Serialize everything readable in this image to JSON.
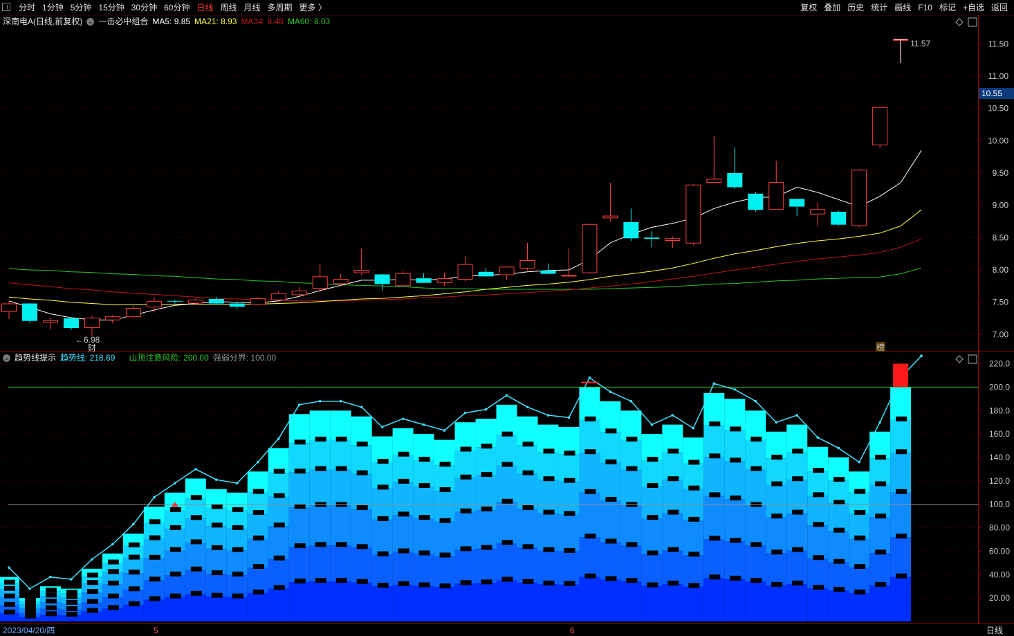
{
  "toolbar": {
    "tabs": [
      "分时",
      "1分钟",
      "5分钟",
      "15分钟",
      "30分钟",
      "60分钟",
      "日线",
      "周线",
      "月线",
      "多周期",
      "更多 〉"
    ],
    "active_tab": "日线",
    "right_buttons": [
      "复权",
      "叠加",
      "历史",
      "统计",
      "画线",
      "F10",
      "标记",
      "+自选",
      "返回"
    ]
  },
  "main_legend": {
    "stock": "深南电A(日线,前复权)",
    "indicator": "一击必中组合",
    "ma5": "MA5: 9.85",
    "ma21": "MA21: 8.93",
    "ma34": "MA34: 8.48",
    "ma60": "MA60: 8.03"
  },
  "sub_legend": {
    "name": "趋势线提示",
    "trend": "趋势线: 218.69",
    "top_risk": "山顶注意风险: 200.00",
    "strength": "强弱分界: 100.00"
  },
  "price_axis": [
    "11.50",
    "11.00",
    "10.50",
    "10.00",
    "9.50",
    "9.00",
    "8.50",
    "8.00",
    "7.50",
    "7.00"
  ],
  "current_price": "10.55",
  "sub_axis": [
    "220.0",
    "200.0",
    "180.0",
    "160.0",
    "140.0",
    "120.0",
    "100.0",
    "80.00",
    "60.00",
    "40.00",
    "20.00"
  ],
  "annotations": {
    "high": "11.57",
    "low": "←6.98",
    "fin": "财",
    "rank": "榜"
  },
  "bottom": {
    "date": "2023/04/20/四",
    "month5": "5",
    "month6": "6",
    "period": "日线"
  },
  "colors": {
    "up": "#ff4040",
    "down": "#00f0f0",
    "ma5": "#ffffff",
    "ma21": "#ffff40",
    "ma34": "#c01818",
    "ma60": "#28c828",
    "grid": "#3a0000"
  },
  "chart_data": [
    {
      "type": "candlestick",
      "title": "深南电A(日线,前复权)",
      "ylim": [
        6.8,
        11.75
      ],
      "candles": [
        {
          "o": 7.35,
          "h": 7.52,
          "l": 7.24,
          "c": 7.48
        },
        {
          "o": 7.48,
          "h": 7.49,
          "l": 7.18,
          "c": 7.21
        },
        {
          "o": 7.18,
          "h": 7.26,
          "l": 7.08,
          "c": 7.22
        },
        {
          "o": 7.25,
          "h": 7.27,
          "l": 7.07,
          "c": 7.1
        },
        {
          "o": 7.1,
          "h": 7.29,
          "l": 6.98,
          "c": 7.26
        },
        {
          "o": 7.22,
          "h": 7.3,
          "l": 7.17,
          "c": 7.28
        },
        {
          "o": 7.27,
          "h": 7.45,
          "l": 7.25,
          "c": 7.41
        },
        {
          "o": 7.42,
          "h": 7.58,
          "l": 7.34,
          "c": 7.52
        },
        {
          "o": 7.52,
          "h": 7.54,
          "l": 7.48,
          "c": 7.51
        },
        {
          "o": 7.48,
          "h": 7.56,
          "l": 7.46,
          "c": 7.54
        },
        {
          "o": 7.55,
          "h": 7.58,
          "l": 7.46,
          "c": 7.48
        },
        {
          "o": 7.48,
          "h": 7.5,
          "l": 7.4,
          "c": 7.43
        },
        {
          "o": 7.46,
          "h": 7.58,
          "l": 7.45,
          "c": 7.56
        },
        {
          "o": 7.53,
          "h": 7.67,
          "l": 7.5,
          "c": 7.64
        },
        {
          "o": 7.61,
          "h": 7.74,
          "l": 7.58,
          "c": 7.68
        },
        {
          "o": 7.71,
          "h": 8.1,
          "l": 7.65,
          "c": 7.9
        },
        {
          "o": 7.78,
          "h": 7.94,
          "l": 7.75,
          "c": 7.86
        },
        {
          "o": 7.95,
          "h": 8.33,
          "l": 7.92,
          "c": 8.0
        },
        {
          "o": 7.93,
          "h": 7.94,
          "l": 7.68,
          "c": 7.78
        },
        {
          "o": 7.75,
          "h": 7.98,
          "l": 7.74,
          "c": 7.95
        },
        {
          "o": 7.87,
          "h": 7.95,
          "l": 7.8,
          "c": 7.8
        },
        {
          "o": 7.8,
          "h": 7.96,
          "l": 7.75,
          "c": 7.87
        },
        {
          "o": 7.85,
          "h": 8.22,
          "l": 7.82,
          "c": 8.09
        },
        {
          "o": 7.97,
          "h": 8.03,
          "l": 7.89,
          "c": 7.9
        },
        {
          "o": 7.92,
          "h": 8.06,
          "l": 7.85,
          "c": 8.05
        },
        {
          "o": 8.02,
          "h": 8.42,
          "l": 8.0,
          "c": 8.15
        },
        {
          "o": 7.99,
          "h": 8.1,
          "l": 7.95,
          "c": 7.94
        },
        {
          "o": 7.91,
          "h": 8.33,
          "l": 7.9,
          "c": 7.92
        },
        {
          "o": 7.95,
          "h": 8.71,
          "l": 7.94,
          "c": 8.71
        },
        {
          "o": 8.8,
          "h": 9.35,
          "l": 8.75,
          "c": 8.84
        },
        {
          "o": 8.74,
          "h": 8.95,
          "l": 8.45,
          "c": 8.49
        },
        {
          "o": 8.5,
          "h": 8.6,
          "l": 8.35,
          "c": 8.48
        },
        {
          "o": 8.45,
          "h": 8.52,
          "l": 8.34,
          "c": 8.49
        },
        {
          "o": 8.41,
          "h": 9.33,
          "l": 8.38,
          "c": 9.32
        },
        {
          "o": 9.35,
          "h": 10.08,
          "l": 9.35,
          "c": 9.41
        },
        {
          "o": 9.5,
          "h": 9.9,
          "l": 9.25,
          "c": 9.28
        },
        {
          "o": 9.18,
          "h": 9.21,
          "l": 8.9,
          "c": 8.93
        },
        {
          "o": 8.93,
          "h": 9.69,
          "l": 8.93,
          "c": 9.36
        },
        {
          "o": 9.1,
          "h": 9.1,
          "l": 8.83,
          "c": 8.98
        },
        {
          "o": 8.86,
          "h": 9.05,
          "l": 8.68,
          "c": 8.94
        },
        {
          "o": 8.9,
          "h": 8.92,
          "l": 8.68,
          "c": 8.7
        },
        {
          "o": 8.68,
          "h": 9.56,
          "l": 8.66,
          "c": 9.55
        },
        {
          "o": 9.93,
          "h": 10.52,
          "l": 9.89,
          "c": 10.52
        },
        {
          "o": 11.57,
          "h": 11.57,
          "l": 11.2,
          "c": 11.57
        }
      ],
      "ma5": [
        7.52,
        7.42,
        7.32,
        7.26,
        7.23,
        7.22,
        7.3,
        7.38,
        7.45,
        7.48,
        7.51,
        7.5,
        7.49,
        7.52,
        7.59,
        7.68,
        7.76,
        7.84,
        7.84,
        7.85,
        7.84,
        7.86,
        7.9,
        7.92,
        7.93,
        7.97,
        7.99,
        8.0,
        8.16,
        8.42,
        8.55,
        8.66,
        8.72,
        8.8,
        8.95,
        9.05,
        9.12,
        9.13,
        9.28,
        9.2,
        9.09,
        8.98,
        9.14,
        9.35,
        9.85
      ],
      "ma21": [
        7.58,
        7.55,
        7.53,
        7.5,
        7.48,
        7.46,
        7.46,
        7.46,
        7.47,
        7.47,
        7.47,
        7.47,
        7.47,
        7.48,
        7.49,
        7.51,
        7.53,
        7.55,
        7.56,
        7.58,
        7.6,
        7.63,
        7.66,
        7.7,
        7.73,
        7.76,
        7.78,
        7.81,
        7.85,
        7.9,
        7.94,
        7.98,
        8.03,
        8.1,
        8.18,
        8.25,
        8.3,
        8.36,
        8.41,
        8.45,
        8.48,
        8.52,
        8.57,
        8.68,
        8.93
      ],
      "ma34": [
        7.8,
        7.77,
        7.74,
        7.71,
        7.69,
        7.66,
        7.64,
        7.62,
        7.6,
        7.58,
        7.56,
        7.55,
        7.54,
        7.53,
        7.52,
        7.52,
        7.52,
        7.53,
        7.54,
        7.55,
        7.57,
        7.58,
        7.6,
        7.61,
        7.63,
        7.65,
        7.67,
        7.69,
        7.72,
        7.75,
        7.78,
        7.82,
        7.86,
        7.9,
        7.95,
        8.0,
        8.04,
        8.09,
        8.13,
        8.17,
        8.2,
        8.23,
        8.27,
        8.35,
        8.48
      ],
      "ma60": [
        8.02,
        8.0,
        7.99,
        7.97,
        7.96,
        7.94,
        7.93,
        7.91,
        7.9,
        7.88,
        7.86,
        7.85,
        7.83,
        7.82,
        7.8,
        7.79,
        7.77,
        7.76,
        7.75,
        7.74,
        7.72,
        7.71,
        7.71,
        7.7,
        7.7,
        7.7,
        7.7,
        7.7,
        7.7,
        7.71,
        7.72,
        7.73,
        7.74,
        7.76,
        7.78,
        7.79,
        7.81,
        7.83,
        7.84,
        7.86,
        7.87,
        7.88,
        7.89,
        7.94,
        8.03
      ]
    },
    {
      "type": "area",
      "title": "趋势线提示",
      "ylim": [
        0,
        228
      ],
      "trend": [
        38,
        20,
        30,
        28,
        45,
        58,
        75,
        98,
        110,
        122,
        113,
        110,
        128,
        148,
        177,
        180,
        180,
        175,
        158,
        165,
        160,
        155,
        170,
        173,
        185,
        175,
        168,
        166,
        200,
        188,
        180,
        160,
        168,
        157,
        195,
        190,
        180,
        162,
        168,
        149,
        140,
        128,
        162,
        200,
        218.69
      ],
      "thresholds": {
        "top_risk": 200,
        "strength": 100
      }
    }
  ]
}
